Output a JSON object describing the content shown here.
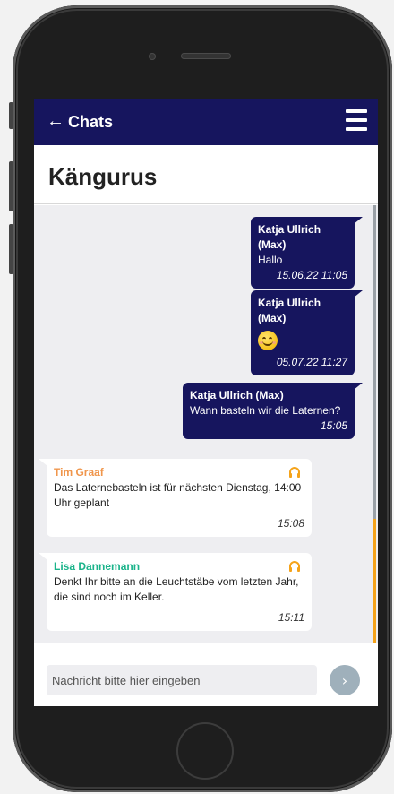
{
  "header": {
    "back_icon": "back-arrow-icon",
    "back_glyph": "←",
    "title": "Chats",
    "menu_icon": "hamburger-menu-icon",
    "color": "#16155e"
  },
  "conversation": {
    "title": "Kängurus"
  },
  "messages": [
    {
      "direction": "out",
      "sender": "Katja Ullrich (Max)",
      "text": "Hallo",
      "time": "15.06.22 11:05"
    },
    {
      "direction": "out",
      "sender": "Katja Ullrich (Max)",
      "text": "",
      "emoji": "smiling-face-icon",
      "time": "05.07.22 11:27"
    },
    {
      "direction": "out",
      "sender": "Katja Ullrich (Max)",
      "text": "Wann basteln wir die Laternen?",
      "time": "15:05"
    },
    {
      "direction": "in",
      "sender": "Tim Graaf",
      "sender_color": "#f0964c",
      "text": "Das Laternebasteln ist für nächsten Dienstag, 14:00 Uhr geplant",
      "time": "15:08",
      "icon": "headset-icon",
      "icon_color": "#f5a31a"
    },
    {
      "direction": "in",
      "sender": "Lisa Dannemann",
      "sender_color": "#1ab38a",
      "text": "Denkt Ihr bitte an die Leuchtstäbe vom letzten Jahr, die sind noch im Keller.",
      "time": "15:11",
      "icon": "headset-icon",
      "icon_color": "#f5a31a"
    }
  ],
  "composer": {
    "placeholder": "Nachricht bitte hier eingeben",
    "value": "",
    "send_glyph": "›",
    "send_icon": "chevron-right-icon"
  },
  "colors": {
    "accent": "#16155e",
    "chat_background": "#eeeef1",
    "scroll_thumb": "#f5a31a"
  }
}
